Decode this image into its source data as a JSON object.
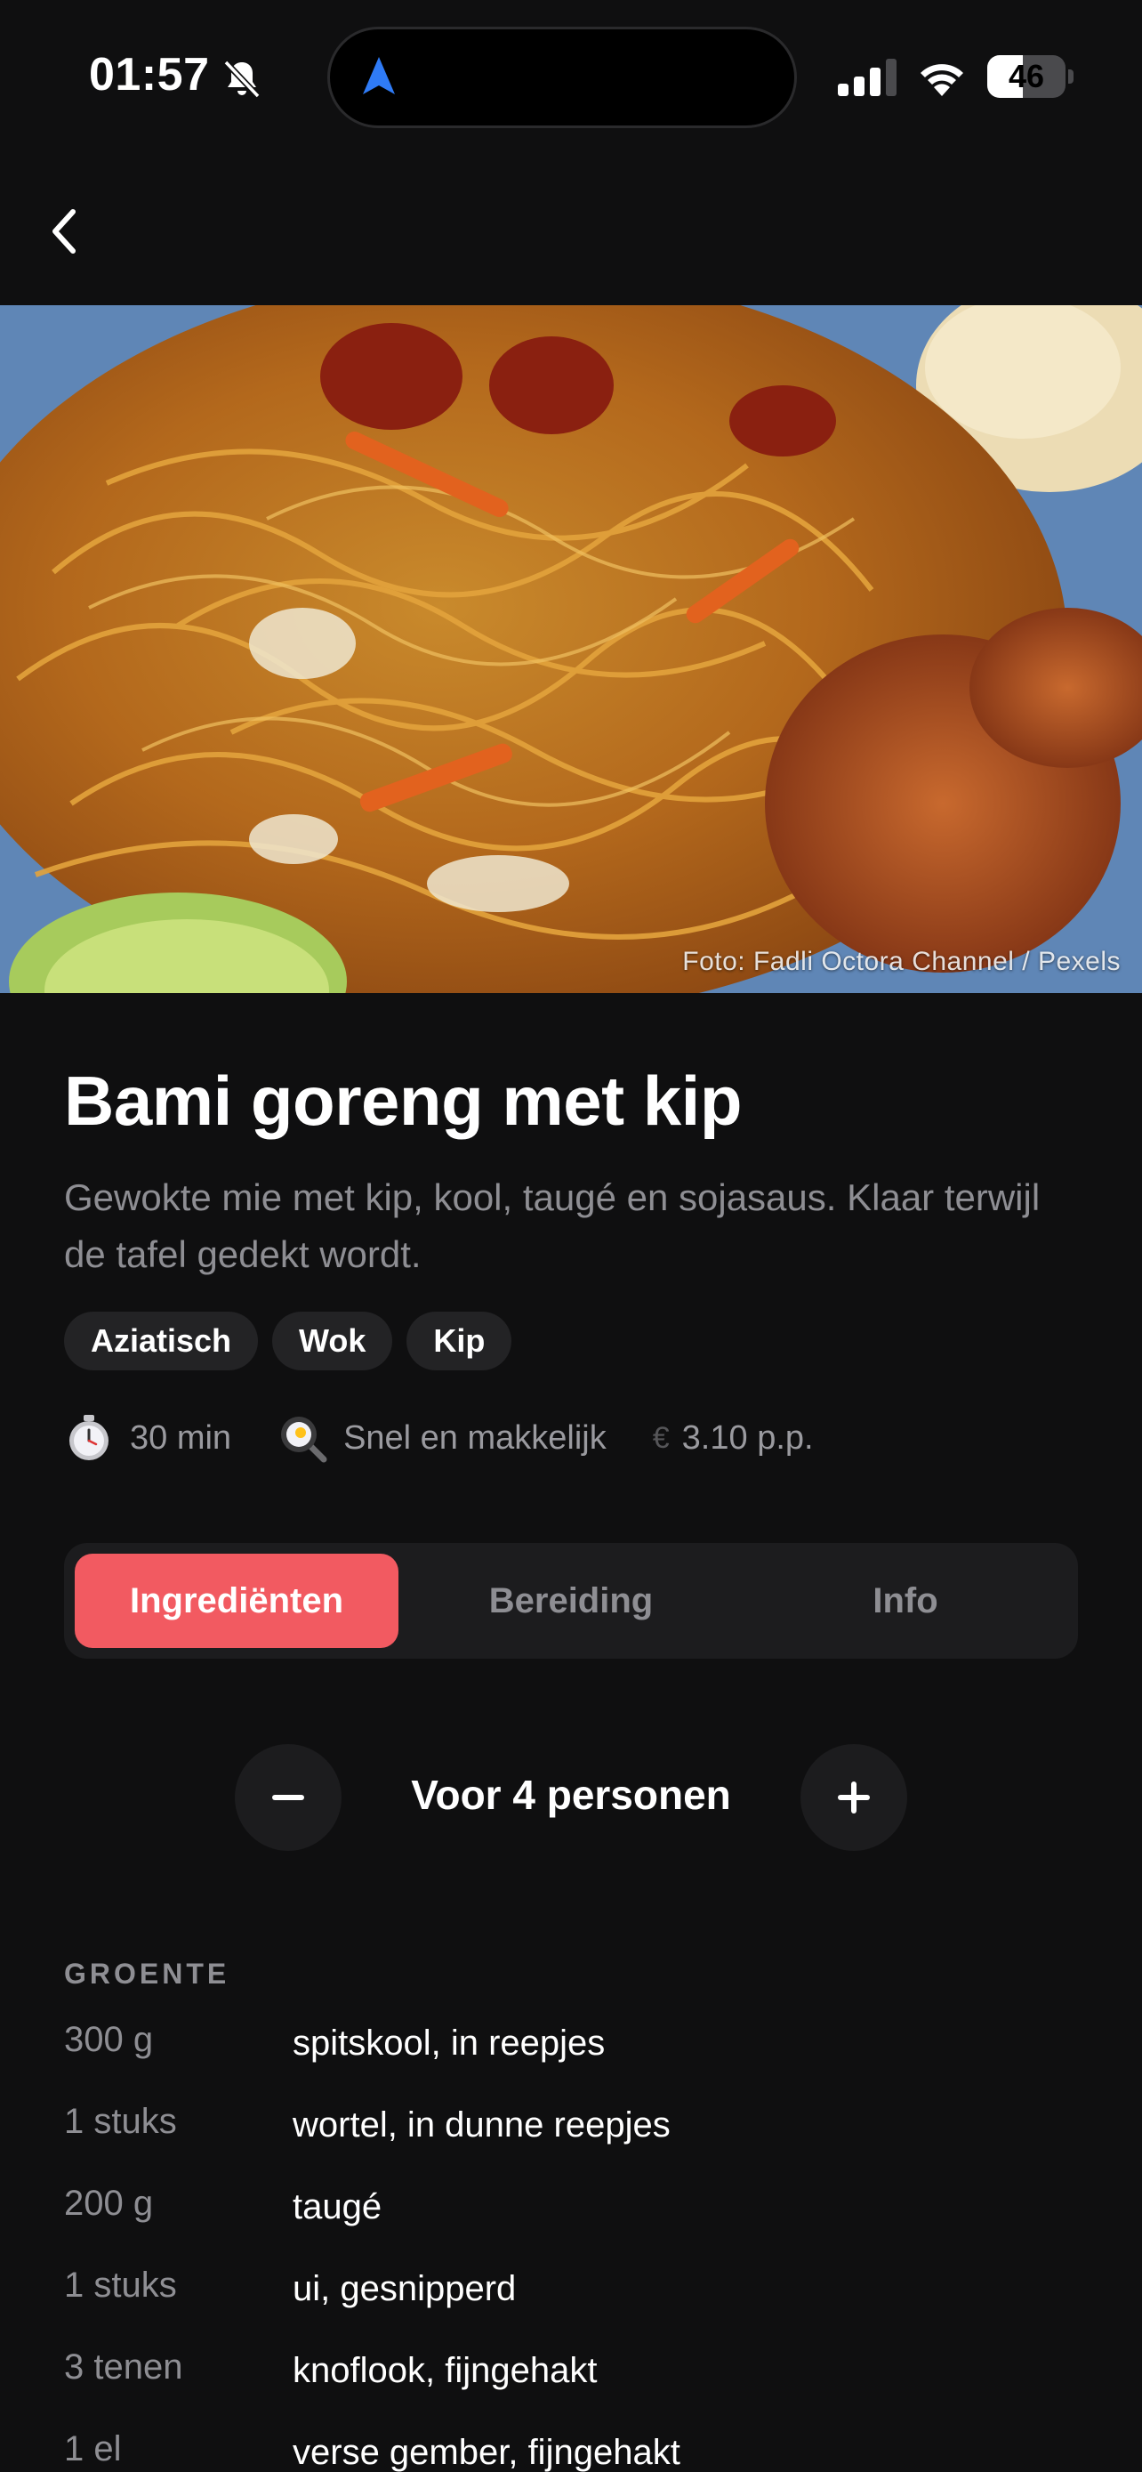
{
  "status_bar": {
    "time": "01:57",
    "battery_percent": "46",
    "battery_level": 0.46,
    "icons": [
      "bell-slash-icon",
      "navigation-arrow-icon",
      "signal-icon",
      "wifi-icon",
      "battery-icon"
    ]
  },
  "header": {
    "back_icon": "chevron-left-icon"
  },
  "hero": {
    "photo_credit": "Foto: Fadli Octora Channel / Pexels"
  },
  "recipe": {
    "title": "Bami goreng met kip",
    "description": "Gewokte mie met kip, kool, taugé en sojasaus. Klaar terwijl de tafel gedekt wordt.",
    "tags": [
      "Aziatisch",
      "Wok",
      "Kip"
    ],
    "meta": {
      "time": "30 min",
      "difficulty": "Snel en makkelijk",
      "currency_symbol": "€",
      "price": "3.10 p.p."
    }
  },
  "tabs": [
    {
      "label": "Ingrediënten",
      "active": true
    },
    {
      "label": "Bereiding",
      "active": false
    },
    {
      "label": "Info",
      "active": false
    }
  ],
  "servings": {
    "label": "Voor 4 personen",
    "minus_icon": "minus-icon",
    "plus_icon": "plus-icon"
  },
  "ingredients": {
    "section": "GROENTE",
    "items": [
      {
        "qty": "300 g",
        "name": "spitskool, in reepjes"
      },
      {
        "qty": "1 stuks",
        "name": "wortel, in dunne reepjes"
      },
      {
        "qty": "200 g",
        "name": "taugé"
      },
      {
        "qty": "1 stuks",
        "name": "ui, gesnipperd"
      },
      {
        "qty": "3 tenen",
        "name": "knoflook, fijngehakt"
      },
      {
        "qty": "1 el",
        "name": "verse gember, fijngehakt"
      }
    ]
  },
  "colors": {
    "background": "#0f0f10",
    "accent": "#f25a61",
    "surface": "#1c1c1e",
    "muted_text": "#8e8e93",
    "nav_arrow": "#2f7bf6"
  }
}
